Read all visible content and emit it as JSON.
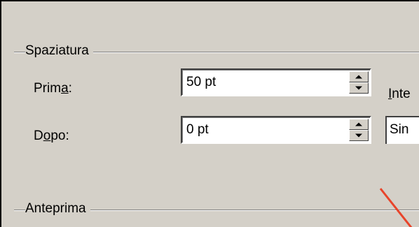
{
  "dialog": {
    "spacing_section": {
      "title": "Spaziatura"
    },
    "preview_section": {
      "title": "Anteprima"
    },
    "before": {
      "label_pre": "Prim",
      "label_accel": "a",
      "label_post": ":",
      "value": "50 pt"
    },
    "after": {
      "label_pre": "D",
      "label_accel": "o",
      "label_post": "po:",
      "value": "0 pt"
    },
    "line_spacing": {
      "label_accel": "I",
      "label_rest": "nte",
      "value": "Sin"
    }
  },
  "colors": {
    "dialog_bg": "#d4d0c8",
    "annotation_red": "#e8442a"
  },
  "icons": [
    "spin-up-arrow-icon",
    "spin-down-arrow-icon"
  ]
}
